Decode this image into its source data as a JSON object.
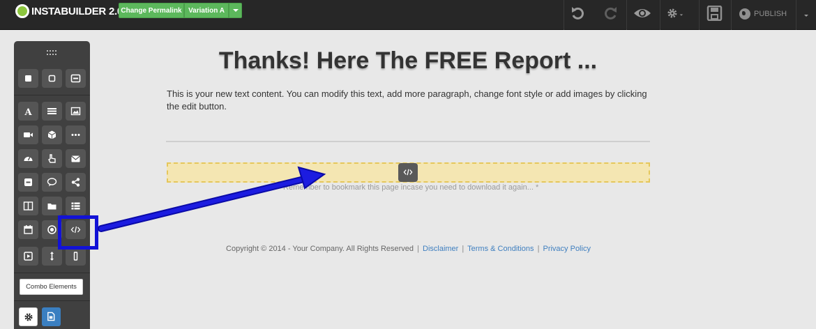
{
  "topbar": {
    "logo_text": "INSTABUILDER",
    "logo_version": "2.0",
    "permalink_button": "Change Permalink",
    "variation_button": "Variation A",
    "publish_label": "PUBLISH"
  },
  "sidebar": {
    "combo_button": "Combo Elements"
  },
  "content": {
    "headline": "Thanks! Here The FREE Report ...",
    "paragraph": "This is your new text content. You can modify this text, add more paragraph, change font style or add images by clicking the edit button.",
    "reminder": "* Remember to bookmark this page incase you need to download it again... *"
  },
  "footer": {
    "copyright": "Copyright © 2014 - Your Company. All Rights Reserved",
    "disclaimer": "Disclaimer",
    "terms": "Terms & Conditions",
    "privacy": "Privacy Policy"
  },
  "colors": {
    "topbar": "#272727",
    "green_button": "#5cb85c",
    "highlight": "#1212d6",
    "code_zone": "#f4e6b2",
    "link": "#3f7fbf",
    "settings_button": "#3a7fc1"
  }
}
